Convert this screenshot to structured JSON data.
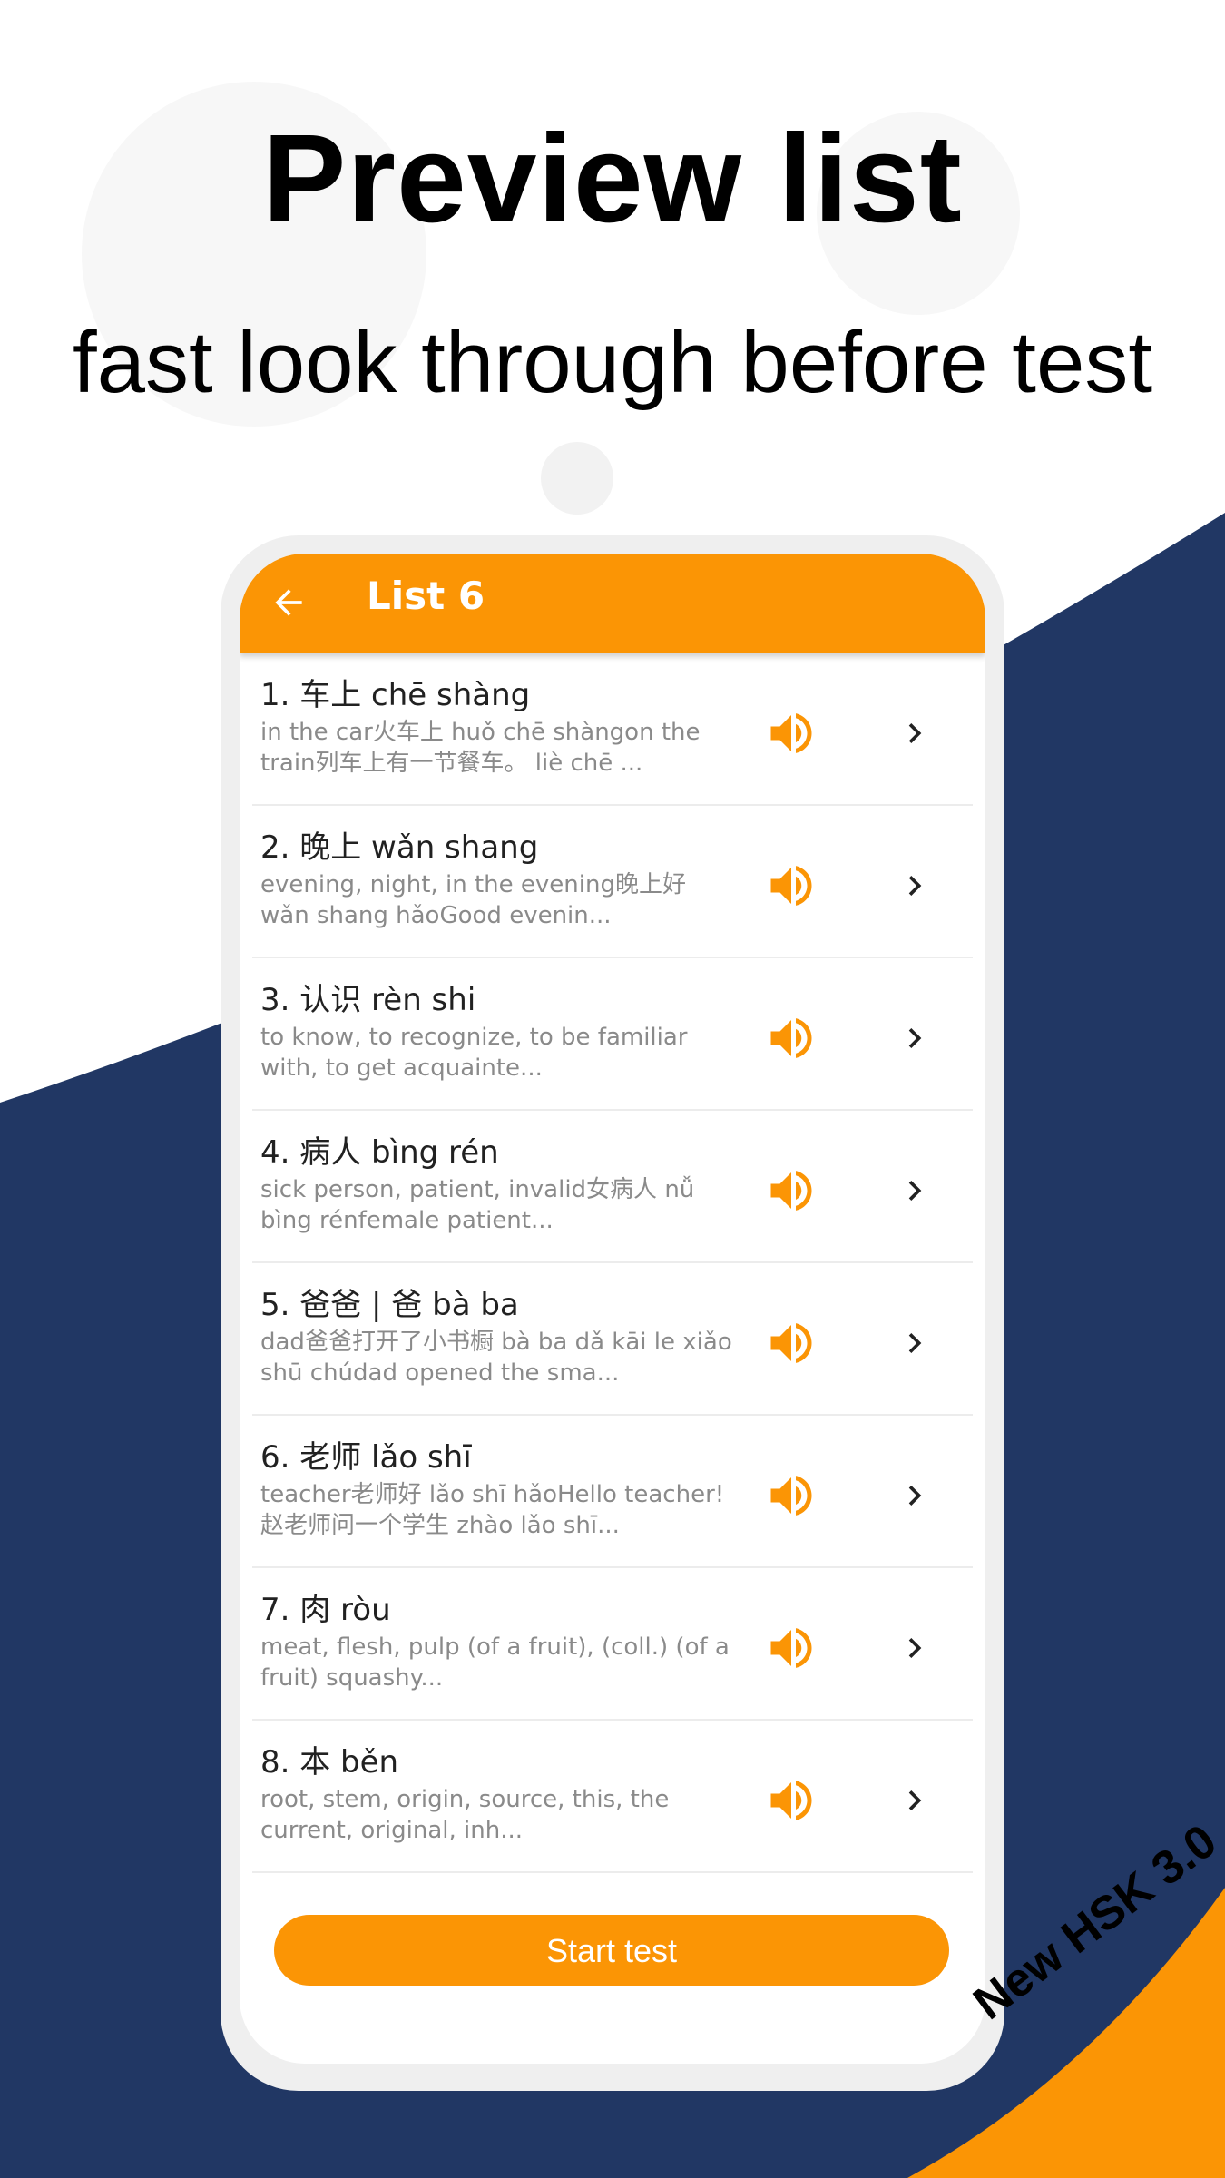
{
  "header": {
    "title": "Preview list",
    "subtitle": "fast look through before test"
  },
  "colors": {
    "accent": "#fb9505",
    "navy": "#213764"
  },
  "app": {
    "title": "List 6",
    "back_icon": "arrow-left-icon",
    "items": [
      {
        "head": "1. 车上  chē shàng",
        "desc": "in the car火车上 huǒ chē shàngon the train列车上有一节餐车。 liè chē ..."
      },
      {
        "head": "2. 晚上  wǎn shang",
        "desc": "evening, night, in the evening晚上好 wǎn shang hǎoGood evenin..."
      },
      {
        "head": "3. 认识  rèn shi",
        "desc": "to know, to recognize, to be familiar with, to get acquainte..."
      },
      {
        "head": "4. 病人  bìng rén",
        "desc": "sick person, patient, invalid女病人 nǚ bìng rénfemale patient..."
      },
      {
        "head": "5. 爸爸 | 爸  bà ba",
        "desc": "dad爸爸打开了小书橱 bà ba dǎ kāi le xiǎo shū chúdad opened the sma..."
      },
      {
        "head": "6. 老师  lǎo shī",
        "desc": "teacher老师好 lǎo shī hǎoHello teacher!赵老师问一个学生 zhào lǎo shī..."
      },
      {
        "head": "7. 肉  ròu",
        "desc": "meat, flesh, pulp (of a fruit), (coll.) (of a fruit) squashy..."
      },
      {
        "head": "8. 本  běn",
        "desc": "root, stem, origin, source, this, the current, original, inh..."
      }
    ],
    "start_label": "Start test"
  },
  "badge": "New HSK 3.0"
}
